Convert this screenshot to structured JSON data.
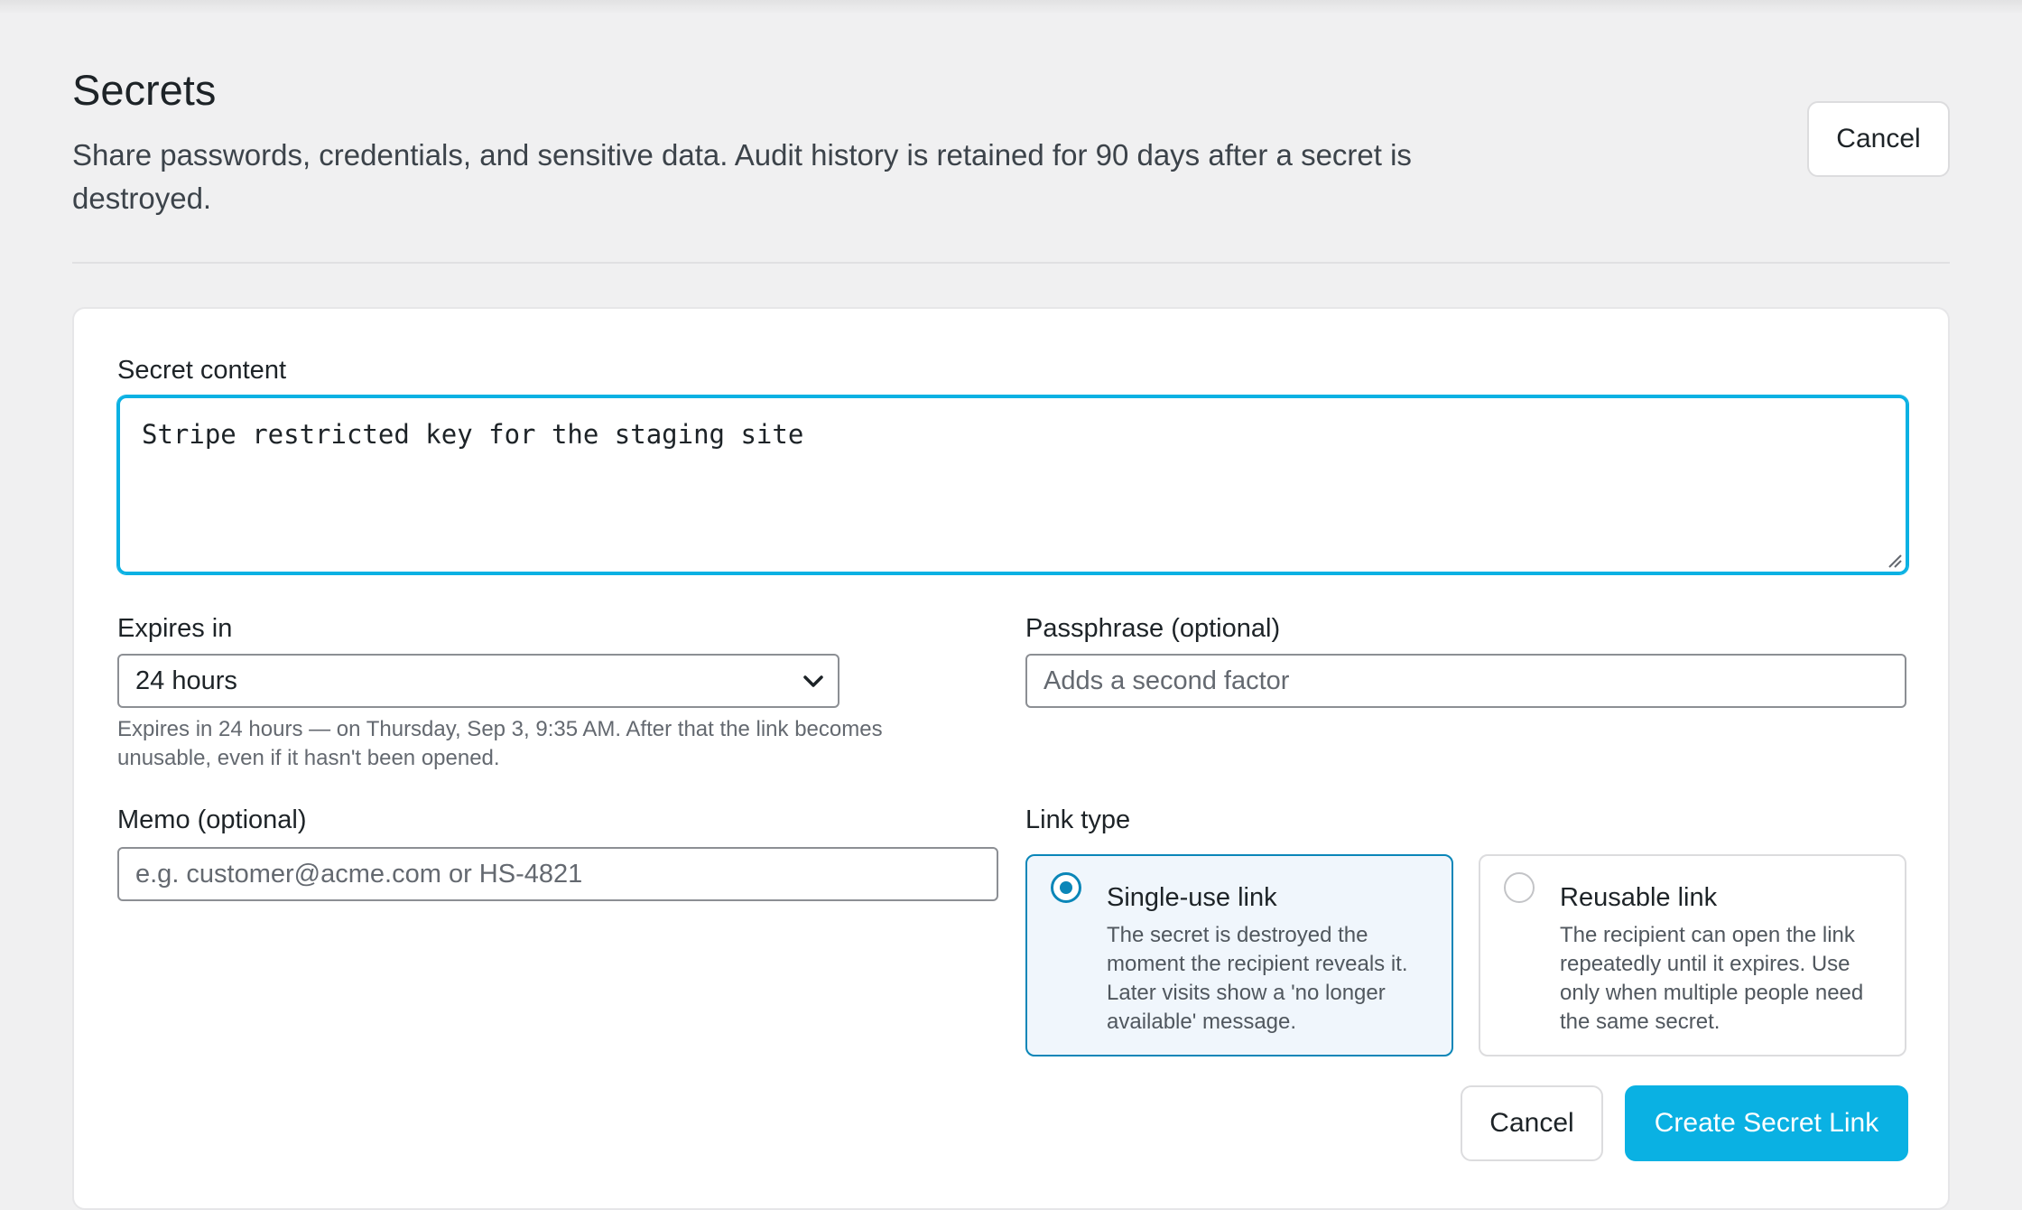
{
  "header": {
    "title": "Secrets",
    "description": "Share passwords, credentials, and sensitive data. Audit history is retained for 90 days after a secret is destroyed.",
    "cancel_label": "Cancel"
  },
  "form": {
    "secret_content": {
      "label": "Secret content",
      "value": "Stripe restricted key for the staging site"
    },
    "expires": {
      "label": "Expires in",
      "selected": "24 hours",
      "help": "Expires in 24 hours — on Thursday, Sep 3, 9:35 AM. After that the link becomes unusable, even if it hasn't been opened."
    },
    "passphrase": {
      "label": "Passphrase (optional)",
      "placeholder": "Adds a second factor"
    },
    "memo": {
      "label": "Memo (optional)",
      "placeholder": "e.g. customer@acme.com or HS-4821"
    },
    "link_type": {
      "label": "Link type",
      "options": [
        {
          "title": "Single-use link",
          "description": "The secret is destroyed the moment the recipient reveals it. Later visits show a 'no longer available' message.",
          "selected": true
        },
        {
          "title": "Reusable link",
          "description": "The recipient can open the link repeatedly until it expires. Use only when multiple people need the same secret.",
          "selected": false
        }
      ]
    }
  },
  "footer": {
    "cancel_label": "Cancel",
    "create_label": "Create Secret Link"
  },
  "colors": {
    "accent": "#0ab1e3",
    "radio_selected": "#0a86b8",
    "selected_card_bg": "#f0f6fc"
  },
  "icons": {
    "select": "chevron-down-icon",
    "textarea_corner": "resize-handle-icon"
  }
}
